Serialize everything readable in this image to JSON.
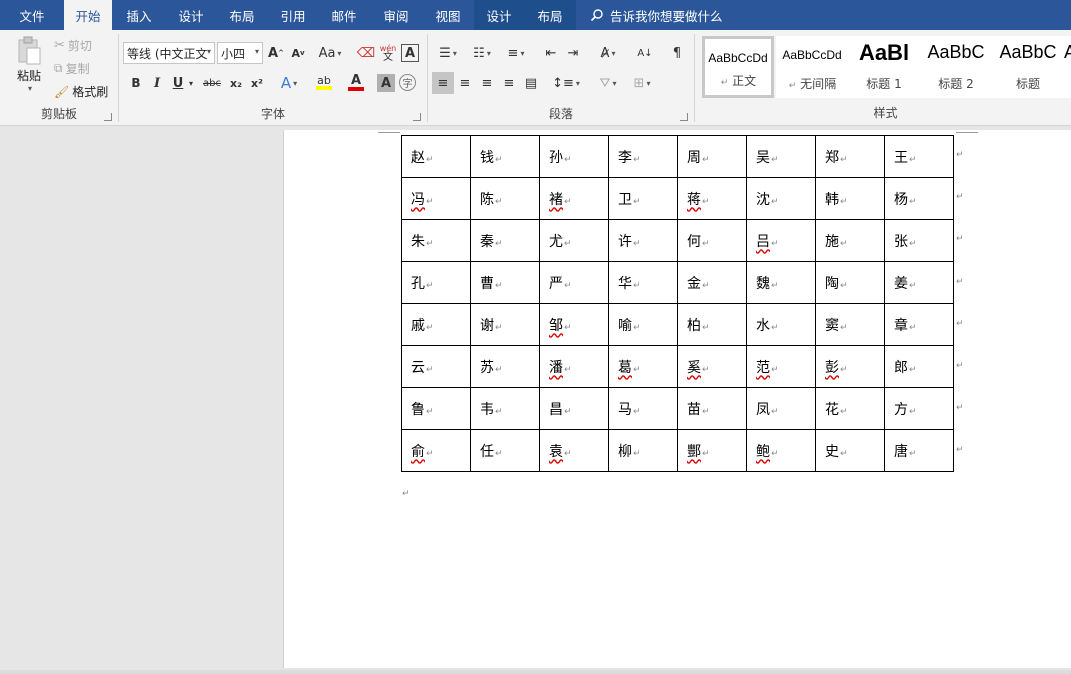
{
  "tabs": [
    {
      "label": "文件"
    },
    {
      "label": "开始"
    },
    {
      "label": "插入"
    },
    {
      "label": "设计"
    },
    {
      "label": "布局"
    },
    {
      "label": "引用"
    },
    {
      "label": "邮件"
    },
    {
      "label": "审阅"
    },
    {
      "label": "视图"
    },
    {
      "label": "设计"
    },
    {
      "label": "布局"
    }
  ],
  "tell_me": "告诉我你想要做什么",
  "clipboard": {
    "paste": "粘贴",
    "cut": "剪切",
    "copy": "复制",
    "format_painter": "格式刷",
    "label": "剪贴板"
  },
  "font": {
    "name": "等线 (中文正文",
    "size": "小四",
    "grow": "A",
    "shrink": "A",
    "case": "Aa",
    "label": "字体",
    "bold": "B",
    "italic": "I",
    "underline": "U",
    "strike": "abc",
    "subscript": "x₂",
    "superscript": "x²",
    "color_a": "A",
    "highlight": "ab",
    "shade_a": "A",
    "phonetic": "wén",
    "enclose": "字"
  },
  "paragraph": {
    "label": "段落"
  },
  "styles": {
    "label": "样式",
    "items": [
      {
        "preview": "AaBbCcDd",
        "name": "正文"
      },
      {
        "preview": "AaBbCcDd",
        "name": "无间隔"
      },
      {
        "preview": "AaBl",
        "name": "标题 1"
      },
      {
        "preview": "AaBbC",
        "name": "标题 2"
      },
      {
        "preview": "AaBbC",
        "name": "标题"
      },
      {
        "preview": "A",
        "name": ""
      }
    ]
  },
  "table": {
    "rows": [
      [
        "赵",
        "钱",
        "孙",
        "李",
        "周",
        "吴",
        "郑",
        "王"
      ],
      [
        "冯",
        "陈",
        "褚",
        "卫",
        "蒋",
        "沈",
        "韩",
        "杨"
      ],
      [
        "朱",
        "秦",
        "尤",
        "许",
        "何",
        "吕",
        "施",
        "张"
      ],
      [
        "孔",
        "曹",
        "严",
        "华",
        "金",
        "魏",
        "陶",
        "姜"
      ],
      [
        "戚",
        "谢",
        "邹",
        "喻",
        "柏",
        "水",
        "窦",
        "章"
      ],
      [
        "云",
        "苏",
        "潘",
        "葛",
        "奚",
        "范",
        "彭",
        "郎"
      ],
      [
        "鲁",
        "韦",
        "昌",
        "马",
        "苗",
        "凤",
        "花",
        "方"
      ],
      [
        "俞",
        "任",
        "袁",
        "柳",
        "酆",
        "鲍",
        "史",
        "唐"
      ]
    ],
    "spell_flags": [
      [
        false,
        false,
        false,
        false,
        false,
        false,
        false,
        false
      ],
      [
        true,
        false,
        true,
        false,
        true,
        false,
        false,
        false
      ],
      [
        false,
        false,
        false,
        false,
        false,
        true,
        false,
        false
      ],
      [
        false,
        false,
        false,
        false,
        false,
        false,
        false,
        false
      ],
      [
        false,
        false,
        true,
        false,
        false,
        false,
        false,
        false
      ],
      [
        false,
        false,
        true,
        true,
        true,
        true,
        true,
        false
      ],
      [
        false,
        false,
        false,
        false,
        false,
        false,
        false,
        false
      ],
      [
        true,
        false,
        true,
        false,
        true,
        true,
        false,
        false
      ]
    ]
  },
  "marks": {
    "cell_end": "↵",
    "paragraph": "↵"
  }
}
